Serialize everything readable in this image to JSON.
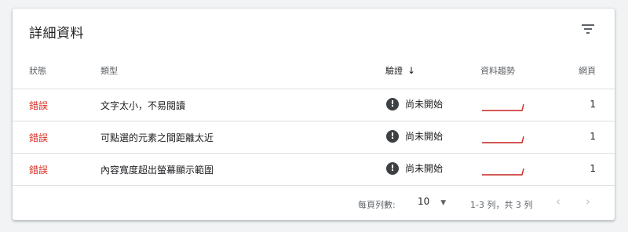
{
  "card": {
    "title": "詳細資料",
    "filter_icon": "filter-list-icon"
  },
  "table": {
    "headers": {
      "status": "狀態",
      "type": "類型",
      "verify": "驗證",
      "sort_icon": "arrow-down-icon",
      "trend": "資料趨勢",
      "pages": "網頁"
    },
    "rows": [
      {
        "status": "錯誤",
        "type": "文字太小，不易閱讀",
        "verify": "尚未開始",
        "trend_icon": "trend-sparkline",
        "pages": "1"
      },
      {
        "status": "錯誤",
        "type": "可點選的元素之間距離太近",
        "verify": "尚未開始",
        "trend_icon": "trend-sparkline",
        "pages": "1"
      },
      {
        "status": "錯誤",
        "type": "內容寬度超出螢幕顯示範圍",
        "verify": "尚未開始",
        "trend_icon": "trend-sparkline",
        "pages": "1"
      }
    ]
  },
  "footer": {
    "rows_per_page_label": "每頁列數:",
    "rows_per_page_value": "10",
    "range_text": "1-3 列，共 3 列"
  },
  "colors": {
    "error": "#d93025",
    "sparkline": "#c5221f",
    "badge": "#3c4043"
  }
}
